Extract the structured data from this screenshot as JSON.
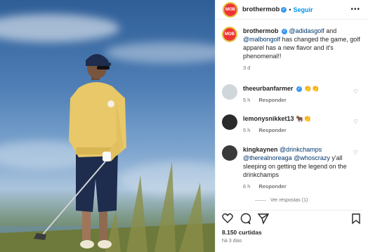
{
  "post": {
    "username": "brothermob",
    "follow_label": "Seguir",
    "dot": "•",
    "caption": {
      "username": "brothermob",
      "m1": "@adidasgolf",
      "t1": " and ",
      "m2": "@malbongolf",
      "t2": " has changed the game, golf apparel has a new flavor and it's phenomenal!!",
      "time": "3 d"
    }
  },
  "comments": [
    {
      "username": "theeurbanfarmer",
      "text": "👏👏",
      "time": "5 h",
      "reply_label": "Responder"
    },
    {
      "username": "lemonysnikket13",
      "text": "🐂👏",
      "time": "5 h",
      "reply_label": "Responder"
    },
    {
      "username": "kingkaynen",
      "m1": "@drinkchamps",
      "m2": "@therealnoreaga",
      "m3": "@whoscrazy",
      "text": " y'all sleeping on getting the legend on the drinkchamps",
      "time": "6 h",
      "reply_label": "Responder"
    }
  ],
  "see_replies": "Ver respostas (1)",
  "likes": "8.150 curtidas",
  "posted_ago": "há 3 dias",
  "icons": [
    "heart-icon",
    "comment-icon",
    "share-icon",
    "save-icon",
    "more-icon",
    "verified-icon"
  ],
  "colors": {
    "accent": "#0095f6",
    "verified": "#3897f0",
    "mention": "#00376b",
    "shirt": "#e8c868"
  }
}
